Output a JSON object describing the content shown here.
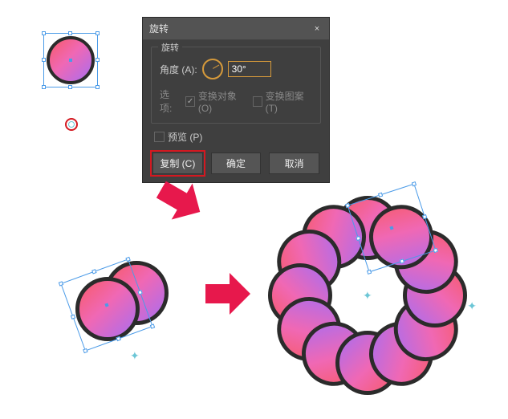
{
  "dialog": {
    "title": "旋转",
    "group_label": "旋转",
    "angle_label": "角度 (A):",
    "angle_value": "30°",
    "options_label": "选项:",
    "opt_transform_objects": "变换对象 (O)",
    "opt_transform_patterns": "变换图案 (T)",
    "preview_label": "预览 (P)",
    "btn_copy": "复制 (C)",
    "btn_ok": "确定",
    "btn_cancel": "取消",
    "close_glyph": "×"
  },
  "colors": {
    "accent_red": "#e7184c",
    "highlight": "#d41820",
    "selection": "#4b9be8",
    "pivot": "#6cc6d6"
  },
  "marks": {
    "star": "✦"
  }
}
